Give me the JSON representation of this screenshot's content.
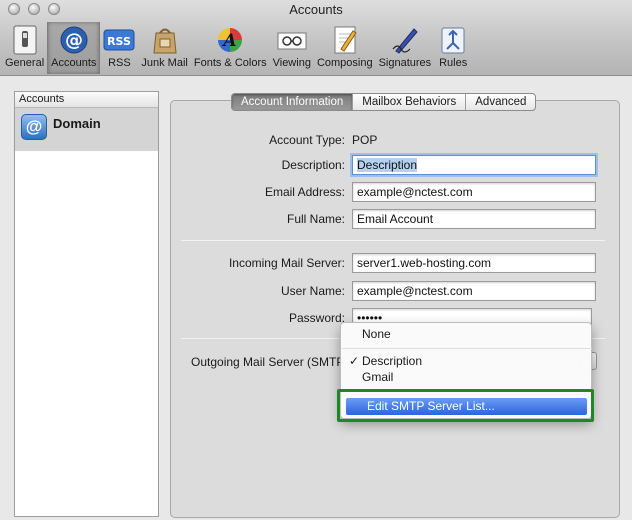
{
  "window": {
    "title": "Accounts"
  },
  "toolbar": [
    {
      "label": "General",
      "icon": "general-switch-icon"
    },
    {
      "label": "Accounts",
      "icon": "at-sign-icon"
    },
    {
      "label": "RSS",
      "icon": "rss-icon"
    },
    {
      "label": "Junk Mail",
      "icon": "junk-bag-icon"
    },
    {
      "label": "Fonts & Colors",
      "icon": "fonts-colors-icon"
    },
    {
      "label": "Viewing",
      "icon": "viewing-glasses-icon"
    },
    {
      "label": "Composing",
      "icon": "composing-pencil-icon"
    },
    {
      "label": "Signatures",
      "icon": "signature-pen-icon"
    },
    {
      "label": "Rules",
      "icon": "rules-icon"
    }
  ],
  "sidebar": {
    "header": "Accounts",
    "account": {
      "name": "Domain",
      "icon_glyph": "@"
    }
  },
  "tabs": [
    "Account Information",
    "Mailbox Behaviors",
    "Advanced"
  ],
  "form": {
    "account_type_label": "Account Type:",
    "account_type_value": "POP",
    "description_label": "Description:",
    "description_value": "Description",
    "email_label": "Email Address:",
    "email_value": "example@nctest.com",
    "fullname_label": "Full Name:",
    "fullname_value": "Email Account",
    "incoming_label": "Incoming Mail Server:",
    "incoming_value": "server1.web-hosting.com",
    "username_label": "User Name:",
    "username_value": "example@nctest.com",
    "password_label": "Password:",
    "password_value": "••••••",
    "smtp_label": "Outgoing Mail Server (SMTP"
  },
  "smtp_menu": {
    "none": "None",
    "checkmark": "✓",
    "description": "Description",
    "gmail": "Gmail",
    "edit": "Edit SMTP Server List..."
  },
  "colors": {
    "accent_selection": "#3b6fe0",
    "highlight_outline": "#1b8a22"
  }
}
